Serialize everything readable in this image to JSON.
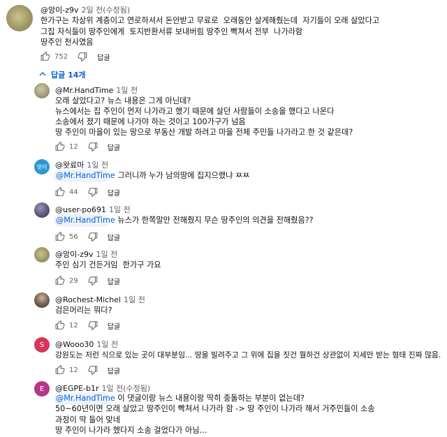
{
  "main_comment": {
    "author": "@앙이-z9v",
    "time": "2일 전(수정됨)",
    "lines": [
      "한가구는 차상위 계층이고 연로하셔서 돈안받고 무료로  오래동안 살게해줬는데  자기들이 오래 살았다고",
      "그집 자식들이 땅주인에게  토지반환서류 보내버림 땅주인 빡쳐서 전부  나가라함",
      "땅주인 천사였음"
    ],
    "likes": "752",
    "reply_label": "답글"
  },
  "replies_toggle": {
    "label": "답글 14개"
  },
  "replies": [
    {
      "author": "@Mr.HandTime",
      "time": "1일 전",
      "lines": [
        "오래 살았다고? 뉴스 내용은 그게 아닌데?",
        "뉴스에서는 집 주인이 먼저 나가라고 했기 때문에 살던 사람들이 소송을 했다고 나온다",
        "소송에서 졌기 때문에 나가야 하는 것이고 100가구가 넘음",
        "땅 주인이 마을이 있는 땅으로 부동산 개발 하려고 마을 전체 주민들 나가라고 한 것 같은데?"
      ],
      "likes": "12",
      "reply_label": "답글"
    },
    {
      "author": "@왓료마",
      "time": "1일 전",
      "avatar_text": "왓이",
      "mention": "@Mr.HandTime",
      "lines": [
        "그러니까 누가 남의땅에 집지으랬냐 ㅉㅉ"
      ],
      "likes": "44",
      "reply_label": "답글"
    },
    {
      "author": "@user-po691",
      "time": "1일 전",
      "mention": "@Mr.HandTime",
      "lines": [
        "뉴스가 한쪽말만 전해줬지 무슨 땅주인의 의견을 전해줬음??"
      ],
      "likes": "56",
      "reply_label": "답글"
    },
    {
      "author": "@앙이-z9v",
      "time": "1일 전",
      "lines": [
        "주인 심기 건든거임  한가구 가요"
      ],
      "likes": "29",
      "reply_label": "답글"
    },
    {
      "author": "@Rochest-Michel",
      "time": "1일 전",
      "lines": [
        "검은머리는 뭐다?"
      ],
      "likes": "12",
      "reply_label": "답글"
    },
    {
      "author": "@Wooo30",
      "time": "1일 전",
      "avatar_text": "S",
      "lines": [
        "강원도는 저런 식으로 있는 곳이 대부분임... 땅을 빌려주고 그 위에 집을 짓건 뭘하건 상관없이 지세만 받는 형태 진짜 많음."
      ],
      "likes": "12",
      "reply_label": "답글"
    },
    {
      "author": "@EGPE-b1r",
      "time": "1일 전(수정됨)",
      "avatar_text": "E",
      "mention": "@Mr.HandTime",
      "lines": [
        "이 댓글이랑 뉴스 내용이랑 딱히 충돌하는 부분이 없는데?",
        "50~60년이면 오래 살았고 땅주인이 빡쳐서 나가라 함 -> 땅 주인이 나가라 해서 거주민들이 소송",
        "과정이 딱 들어 맞네",
        "땅 주인이 나가라 했다지 소송 걸었다가 아님..."
      ]
    }
  ],
  "colors": {
    "link": "#065fd4",
    "secondary_text": "#606060",
    "avatar_wang": "#2b97d6",
    "avatar_s": "#d5355c",
    "avatar_e": "#b53788"
  },
  "icons": [
    "like-icon",
    "dislike-icon",
    "chevron-up-icon"
  ]
}
